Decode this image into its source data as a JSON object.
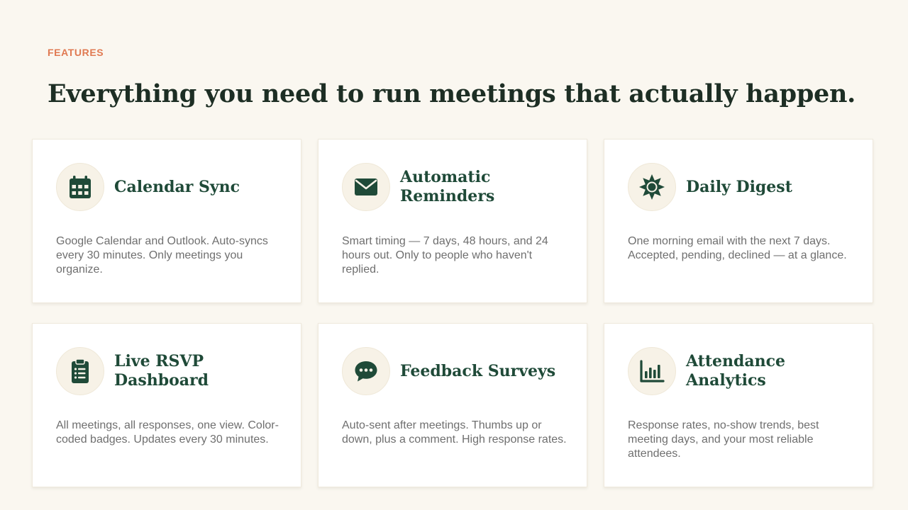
{
  "section": {
    "eyebrow": "FEATURES",
    "headline": "Everything you need to run meetings that actually happen."
  },
  "colors": {
    "background": "#faf7f0",
    "accent": "#e07a52",
    "heading": "#1d2e24",
    "brand_green": "#1f4a38",
    "icon_bg": "#f7f2e7",
    "body_text": "#6f6f6f"
  },
  "features": [
    {
      "icon": "calendar-icon",
      "title": "Calendar Sync",
      "description": "Google Calendar and Outlook. Auto-syncs every 30 minutes. Only meetings you organize."
    },
    {
      "icon": "envelope-icon",
      "title": "Automatic Reminders",
      "description": "Smart timing — 7 days, 48 hours, and 24 hours out. Only to people who haven't replied."
    },
    {
      "icon": "sun-icon",
      "title": "Daily Digest",
      "description": "One morning email with the next 7 days. Accepted, pending, declined — at a glance."
    },
    {
      "icon": "clipboard-list-icon",
      "title": "Live RSVP Dashboard",
      "description": "All meetings, all responses, one view. Color-coded badges. Updates every 30 minutes."
    },
    {
      "icon": "chat-bubble-icon",
      "title": "Feedback Surveys",
      "description": "Auto-sent after meetings. Thumbs up or down, plus a comment. High response rates."
    },
    {
      "icon": "bar-chart-icon",
      "title": "Attendance Analytics",
      "description": "Response rates, no-show trends, best meeting days, and your most reliable attendees."
    }
  ]
}
